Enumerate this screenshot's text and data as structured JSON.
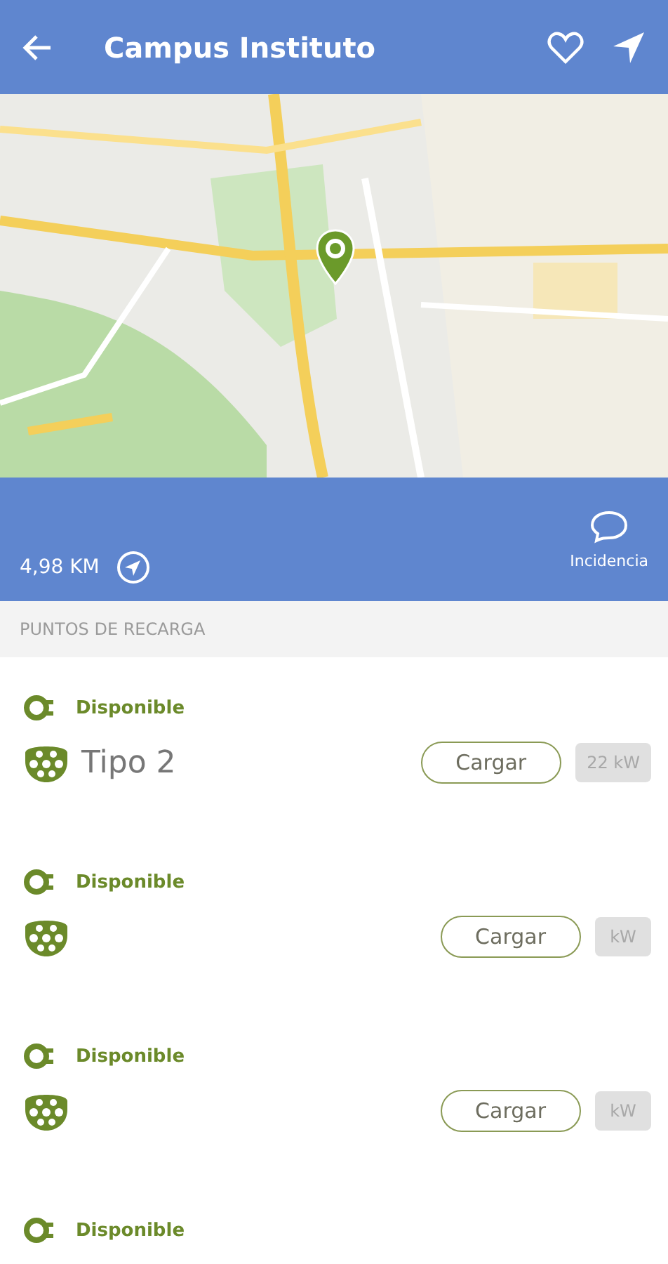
{
  "header": {
    "title": "Campus Instituto"
  },
  "info_bar": {
    "distance": "4,98 KM",
    "report_label": "Incidencia"
  },
  "section": {
    "title": "PUNTOS DE RECARGA"
  },
  "chargers": [
    {
      "status": "Disponible",
      "connector": "Tipo 2",
      "action": "Cargar",
      "power": "22 kW"
    },
    {
      "status": "Disponible",
      "action": "Cargar",
      "power": "kW"
    },
    {
      "status": "Disponible",
      "action": "Cargar",
      "power": "kW"
    },
    {
      "status": "Disponible"
    }
  ]
}
